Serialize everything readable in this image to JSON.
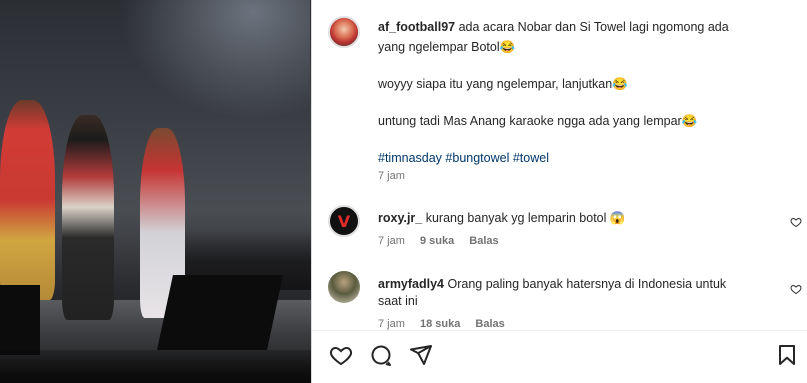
{
  "post": {
    "username": "af_football97",
    "caption_line1": "ada acara Nobar dan Si Towel lagi ngomong ada",
    "caption_line2": "yang ngelempar Botol😂",
    "caption_line3": "woyyy siapa itu yang ngelempar, lanjutkan😂",
    "caption_line4": "untung tadi Mas Anang karaoke ngga ada yang lempar😂",
    "hashtags": [
      "#timnasday",
      "#bungtowel",
      "#towel"
    ],
    "time": "7 jam"
  },
  "comments": [
    {
      "username": "roxy.jr_",
      "text": "kurang banyak yg lemparin botol 😱",
      "time": "7 jam",
      "likes": "9 suka",
      "reply": "Balas"
    },
    {
      "username": "armyfadly4",
      "text_line1": "Orang paling banyak hatersnya di Indonesia untuk",
      "text_line2": "saat ini",
      "time": "7 jam",
      "likes": "18 suka",
      "reply": "Balas"
    }
  ],
  "icons": {
    "like": "heart-icon",
    "comment": "comment-icon",
    "share": "share-icon",
    "save": "bookmark-icon"
  },
  "colors": {
    "hashtag": "#00376b",
    "meta": "#737373",
    "text": "#262626"
  }
}
